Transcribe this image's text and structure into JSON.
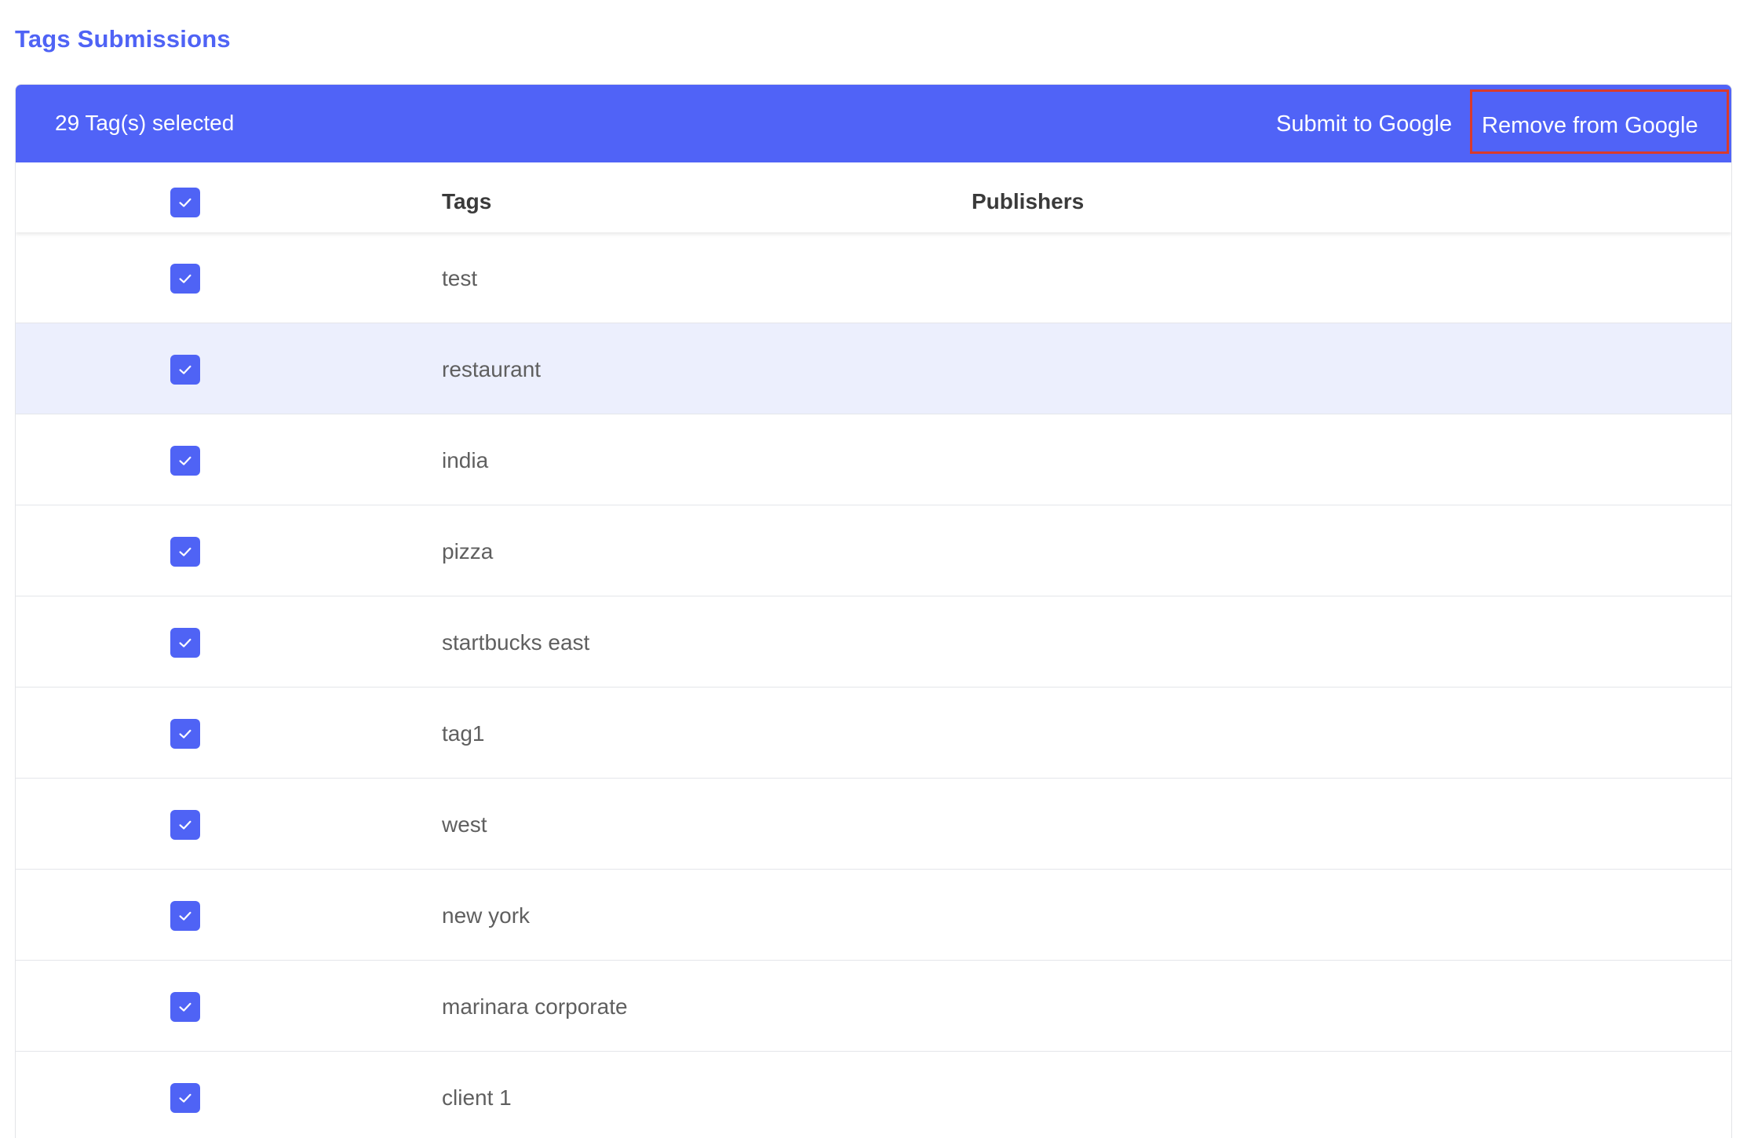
{
  "page": {
    "title": "Tags Submissions"
  },
  "action_bar": {
    "selected_text": "29 Tag(s) selected",
    "submit_label": "Submit to Google",
    "remove_label": "Remove from Google",
    "background_color": "#5063f7",
    "highlight_border_color": "#d93a2b"
  },
  "table": {
    "headers": {
      "select_all_checked": true,
      "tags": "Tags",
      "publishers": "Publishers"
    },
    "rows": [
      {
        "tag": "test",
        "publishers": "",
        "checked": true
      },
      {
        "tag": "restaurant",
        "publishers": "",
        "checked": true,
        "hovered": true
      },
      {
        "tag": "india",
        "publishers": "",
        "checked": true
      },
      {
        "tag": "pizza",
        "publishers": "",
        "checked": true
      },
      {
        "tag": "startbucks east",
        "publishers": "",
        "checked": true
      },
      {
        "tag": "tag1",
        "publishers": "",
        "checked": true
      },
      {
        "tag": "west",
        "publishers": "",
        "checked": true
      },
      {
        "tag": "new york",
        "publishers": "",
        "checked": true
      },
      {
        "tag": "marinara corporate",
        "publishers": "",
        "checked": true
      },
      {
        "tag": "client 1",
        "publishers": "",
        "checked": true
      }
    ]
  },
  "colors": {
    "accent": "#4f63f5",
    "row_hover": "#eceffd"
  },
  "icons": {
    "checkbox": "checkmark-icon"
  }
}
